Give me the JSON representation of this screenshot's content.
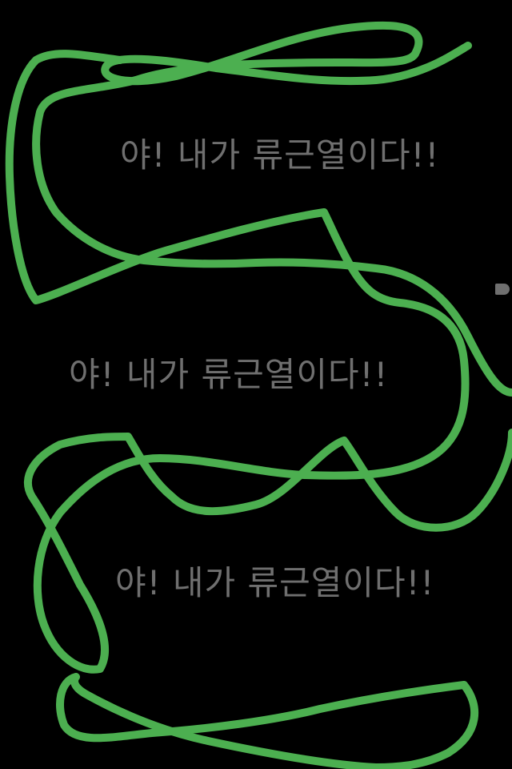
{
  "captions": [
    "야! 내가 류근열이다!!",
    "야! 내가 류근열이다!!",
    "야! 내가 류근열이다!!"
  ],
  "colors": {
    "background": "#000000",
    "stroke": "#4caf50",
    "text": "#6f6f6f"
  }
}
